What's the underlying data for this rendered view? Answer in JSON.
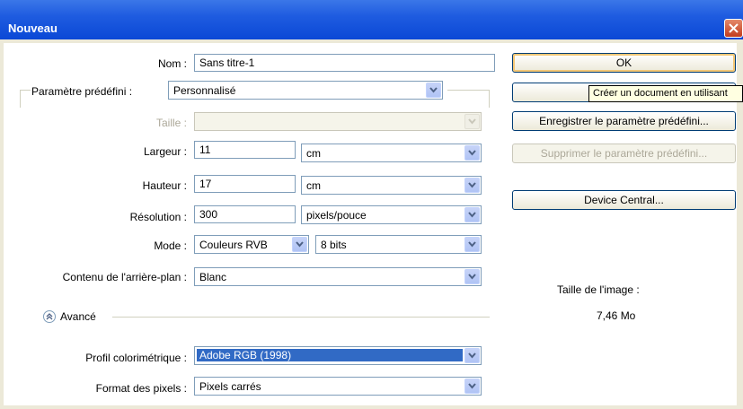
{
  "window": {
    "title": "Nouveau"
  },
  "form": {
    "nom": {
      "label": "Nom :",
      "value": "Sans titre-1"
    },
    "preset": {
      "label": "Paramètre prédéfini :",
      "value": "Personnalisé"
    },
    "taille": {
      "label": "Taille :",
      "value": ""
    },
    "largeur": {
      "label": "Largeur :",
      "value": "11",
      "unit": "cm"
    },
    "hauteur": {
      "label": "Hauteur :",
      "value": "17",
      "unit": "cm"
    },
    "resolution": {
      "label": "Résolution :",
      "value": "300",
      "unit": "pixels/pouce"
    },
    "mode": {
      "label": "Mode :",
      "value": "Couleurs RVB",
      "depth": "8 bits"
    },
    "contenu": {
      "label": "Contenu de l'arrière-plan :",
      "value": "Blanc"
    },
    "avance": {
      "label": "Avancé"
    },
    "profil": {
      "label": "Profil colorimétrique :",
      "value": "Adobe RGB (1998)"
    },
    "format": {
      "label": "Format des pixels :",
      "value": "Pixels carrés"
    }
  },
  "buttons": {
    "ok": "OK",
    "cancel_tooltip": "Créer un document en utilisant",
    "save_preset": "Enregistrer le paramètre prédéfini...",
    "delete_preset": "Supprimer le paramètre prédéfini...",
    "device_central": "Device Central..."
  },
  "image_size": {
    "label": "Taille de l'image :",
    "value": "7,46 Mo"
  },
  "colors": {
    "titlebar": "#0a48d6",
    "highlight": "#316ac5",
    "dialog": "#ece9d8"
  }
}
